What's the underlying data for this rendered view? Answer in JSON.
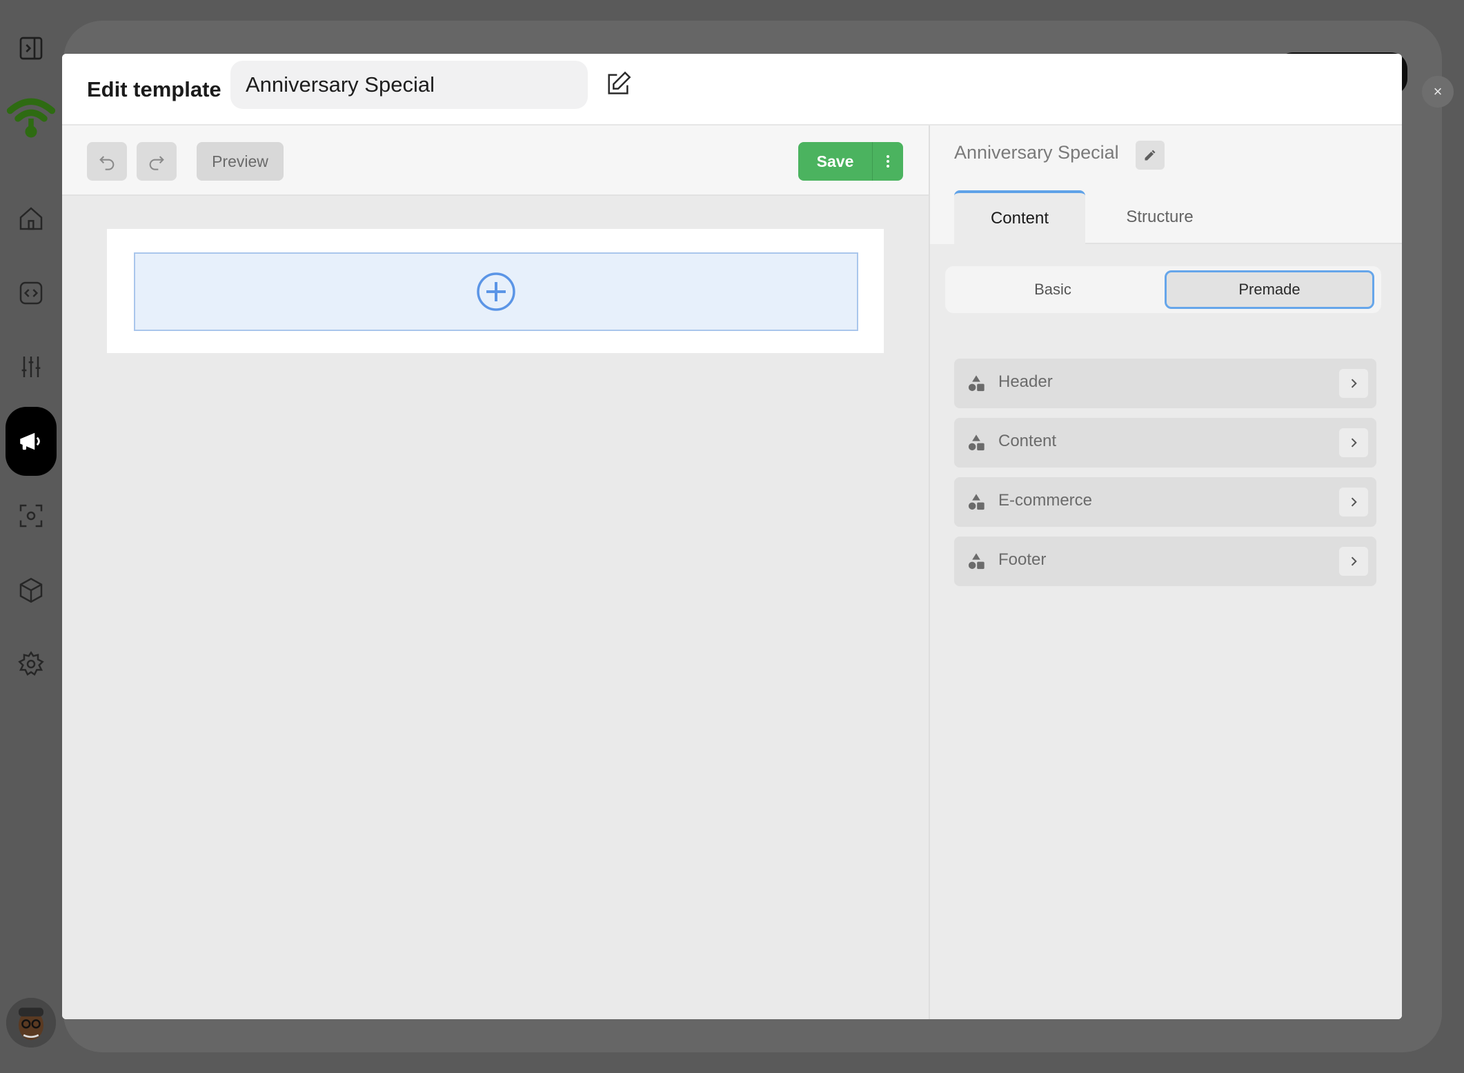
{
  "modal": {
    "title": "Edit template",
    "template_name": "Anniversary Special",
    "close_label": "×"
  },
  "toolbar": {
    "preview_label": "Preview",
    "save_label": "Save"
  },
  "panel": {
    "title": "Anniversary Special",
    "tabs": [
      {
        "label": "Content",
        "active": true
      },
      {
        "label": "Structure",
        "active": false
      }
    ],
    "segments": [
      {
        "label": "Basic",
        "active": false
      },
      {
        "label": "Premade",
        "active": true
      }
    ],
    "categories": [
      {
        "label": "Header",
        "icon": "shapes-icon"
      },
      {
        "label": "Content",
        "icon": "shapes-icon"
      },
      {
        "label": "E-commerce",
        "icon": "shapes-icon"
      },
      {
        "label": "Footer",
        "icon": "shapes-icon"
      }
    ]
  },
  "sidebar": {
    "items": [
      {
        "icon": "panel-toggle-icon"
      },
      {
        "icon": "wifi-logo-icon"
      },
      {
        "icon": "home-icon"
      },
      {
        "icon": "code-icon"
      },
      {
        "icon": "sliders-icon"
      },
      {
        "icon": "megaphone-icon",
        "active": true
      },
      {
        "icon": "scan-icon"
      },
      {
        "icon": "cube-icon"
      },
      {
        "icon": "gear-icon"
      }
    ]
  },
  "colors": {
    "accent_blue": "#5fa2e8",
    "save_green": "#4bb35f",
    "logo_green": "#2e6b12"
  }
}
